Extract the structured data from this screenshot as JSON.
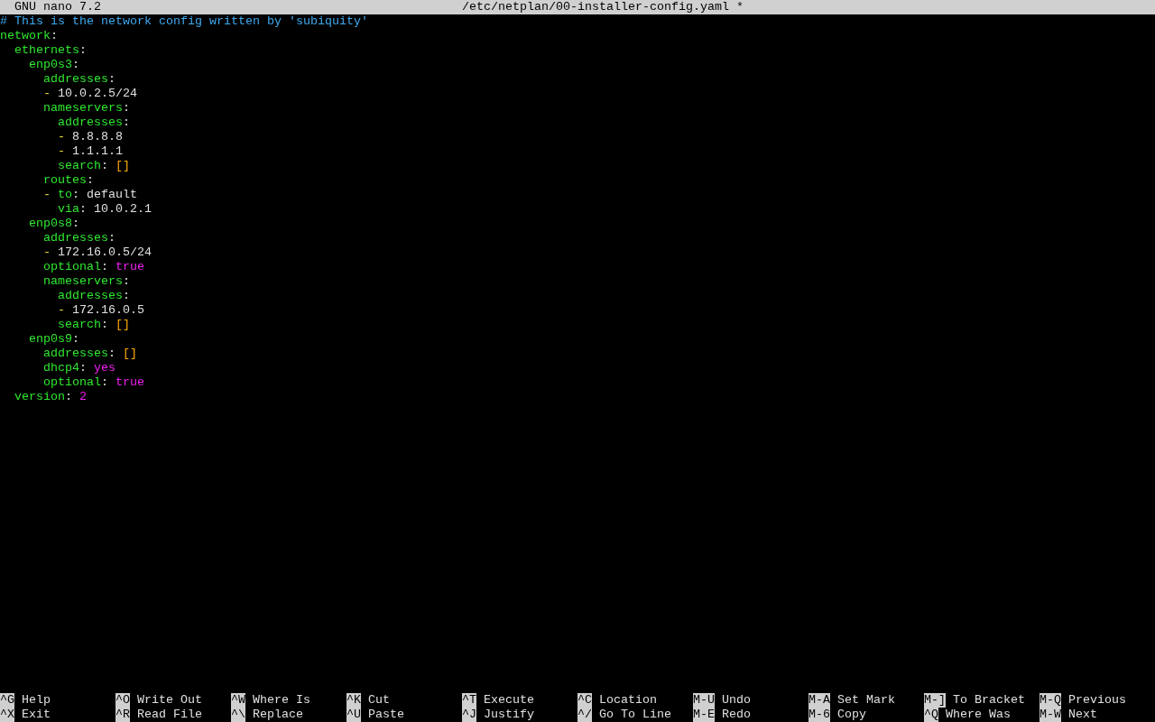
{
  "title_bar": {
    "app": "GNU nano 7.2",
    "file": "/etc/netplan/00-installer-config.yaml *"
  },
  "lines": [
    {
      "tokens": [
        {
          "text": "# This is the network config written by 'subiquity'",
          "kind": "comment"
        }
      ]
    },
    {
      "tokens": [
        {
          "text": "network",
          "kind": "key"
        },
        {
          "text": ":",
          "kind": "punct"
        }
      ],
      "children": [
        {
          "tokens": [
            {
              "text": "ethernets",
              "kind": "key"
            },
            {
              "text": ":",
              "kind": "punct"
            }
          ],
          "children": [
            {
              "tokens": [
                {
                  "text": "enp0s3",
                  "kind": "key"
                },
                {
                  "text": ":",
                  "kind": "punct"
                }
              ],
              "children": [
                {
                  "tokens": [
                    {
                      "text": "addresses",
                      "kind": "key"
                    },
                    {
                      "text": ":",
                      "kind": "punct"
                    }
                  ]
                },
                {
                  "tokens": [
                    {
                      "text": "-",
                      "kind": "dash"
                    },
                    {
                      "text": " 10.0.2.5/24",
                      "kind": "value"
                    }
                  ]
                },
                {
                  "tokens": [
                    {
                      "text": "nameservers",
                      "kind": "key"
                    },
                    {
                      "text": ":",
                      "kind": "punct"
                    }
                  ],
                  "children": [
                    {
                      "tokens": [
                        {
                          "text": "addresses",
                          "kind": "key"
                        },
                        {
                          "text": ":",
                          "kind": "punct"
                        }
                      ]
                    },
                    {
                      "tokens": [
                        {
                          "text": "-",
                          "kind": "dash"
                        },
                        {
                          "text": " 8.8.8.8",
                          "kind": "value"
                        }
                      ]
                    },
                    {
                      "tokens": [
                        {
                          "text": "-",
                          "kind": "dash"
                        },
                        {
                          "text": " 1.1.1.1",
                          "kind": "value"
                        }
                      ]
                    },
                    {
                      "tokens": [
                        {
                          "text": "search",
                          "kind": "key"
                        },
                        {
                          "text": ": ",
                          "kind": "punct"
                        },
                        {
                          "text": "[]",
                          "kind": "bracket"
                        }
                      ]
                    }
                  ]
                },
                {
                  "tokens": [
                    {
                      "text": "routes",
                      "kind": "key"
                    },
                    {
                      "text": ":",
                      "kind": "punct"
                    }
                  ]
                },
                {
                  "tokens": [
                    {
                      "text": "- ",
                      "kind": "dash"
                    },
                    {
                      "text": "to",
                      "kind": "key"
                    },
                    {
                      "text": ": default",
                      "kind": "value"
                    }
                  ],
                  "children": [
                    {
                      "tokens": [
                        {
                          "text": "via",
                          "kind": "key"
                        },
                        {
                          "text": ": 10.0.2.1",
                          "kind": "value"
                        }
                      ]
                    }
                  ]
                }
              ]
            },
            {
              "tokens": [
                {
                  "text": "enp0s8",
                  "kind": "key"
                },
                {
                  "text": ":",
                  "kind": "punct"
                }
              ],
              "children": [
                {
                  "tokens": [
                    {
                      "text": "addresses",
                      "kind": "key"
                    },
                    {
                      "text": ":",
                      "kind": "punct"
                    }
                  ]
                },
                {
                  "tokens": [
                    {
                      "text": "-",
                      "kind": "dash"
                    },
                    {
                      "text": " 172.16.0.5/24",
                      "kind": "value"
                    }
                  ]
                },
                {
                  "tokens": [
                    {
                      "text": "optional",
                      "kind": "key"
                    },
                    {
                      "text": ": ",
                      "kind": "punct"
                    },
                    {
                      "text": "true",
                      "kind": "literal"
                    }
                  ]
                },
                {
                  "tokens": [
                    {
                      "text": "nameservers",
                      "kind": "key"
                    },
                    {
                      "text": ":",
                      "kind": "punct"
                    }
                  ],
                  "children": [
                    {
                      "tokens": [
                        {
                          "text": "addresses",
                          "kind": "key"
                        },
                        {
                          "text": ":",
                          "kind": "punct"
                        }
                      ]
                    },
                    {
                      "tokens": [
                        {
                          "text": "-",
                          "kind": "dash"
                        },
                        {
                          "text": " 172.16.0.5",
                          "kind": "value"
                        }
                      ]
                    },
                    {
                      "tokens": [
                        {
                          "text": "search",
                          "kind": "key"
                        },
                        {
                          "text": ": ",
                          "kind": "punct"
                        },
                        {
                          "text": "[]",
                          "kind": "bracket"
                        }
                      ]
                    }
                  ]
                }
              ]
            },
            {
              "tokens": [
                {
                  "text": "enp0s9",
                  "kind": "key"
                },
                {
                  "text": ":",
                  "kind": "punct"
                }
              ],
              "children": [
                {
                  "tokens": [
                    {
                      "text": "addresses",
                      "kind": "key"
                    },
                    {
                      "text": ": ",
                      "kind": "punct"
                    },
                    {
                      "text": "[]",
                      "kind": "bracket"
                    }
                  ]
                },
                {
                  "tokens": [
                    {
                      "text": "dhcp4",
                      "kind": "key"
                    },
                    {
                      "text": ": ",
                      "kind": "punct"
                    },
                    {
                      "text": "yes",
                      "kind": "literal"
                    }
                  ]
                },
                {
                  "tokens": [
                    {
                      "text": "optional",
                      "kind": "key"
                    },
                    {
                      "text": ": ",
                      "kind": "punct"
                    },
                    {
                      "text": "true",
                      "kind": "literal"
                    }
                  ]
                }
              ]
            }
          ]
        },
        {
          "tokens": [
            {
              "text": "version",
              "kind": "key"
            },
            {
              "text": ": ",
              "kind": "punct"
            },
            {
              "text": "2",
              "kind": "literal"
            }
          ]
        }
      ]
    }
  ],
  "shortcuts": [
    [
      {
        "key": "^G",
        "label": "Help"
      },
      {
        "key": "^X",
        "label": "Exit"
      }
    ],
    [
      {
        "key": "^O",
        "label": "Write Out"
      },
      {
        "key": "^R",
        "label": "Read File"
      }
    ],
    [
      {
        "key": "^W",
        "label": "Where Is"
      },
      {
        "key": "^\\",
        "label": "Replace"
      }
    ],
    [
      {
        "key": "^K",
        "label": "Cut"
      },
      {
        "key": "^U",
        "label": "Paste"
      }
    ],
    [
      {
        "key": "^T",
        "label": "Execute"
      },
      {
        "key": "^J",
        "label": "Justify"
      }
    ],
    [
      {
        "key": "^C",
        "label": "Location"
      },
      {
        "key": "^/",
        "label": "Go To Line"
      }
    ],
    [
      {
        "key": "M-U",
        "label": "Undo"
      },
      {
        "key": "M-E",
        "label": "Redo"
      }
    ],
    [
      {
        "key": "M-A",
        "label": "Set Mark"
      },
      {
        "key": "M-6",
        "label": "Copy"
      }
    ],
    [
      {
        "key": "M-]",
        "label": "To Bracket"
      },
      {
        "key": "^Q",
        "label": "Where Was"
      }
    ],
    [
      {
        "key": "M-Q",
        "label": "Previous"
      },
      {
        "key": "M-W",
        "label": "Next"
      }
    ]
  ]
}
